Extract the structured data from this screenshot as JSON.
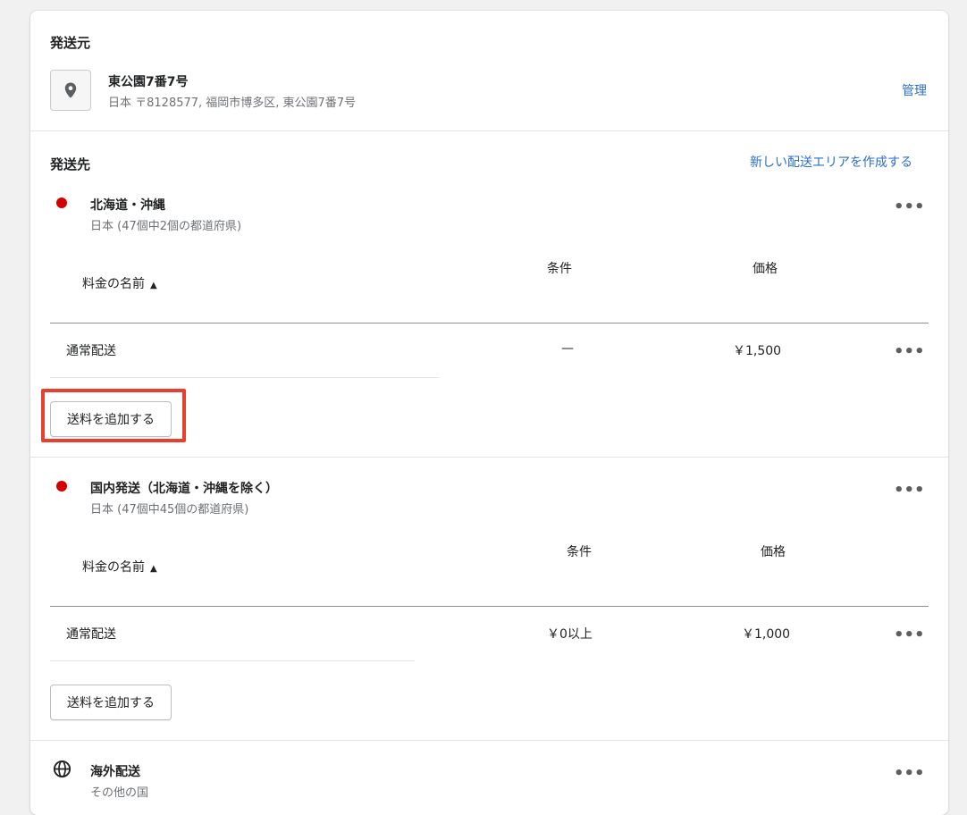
{
  "origin": {
    "heading": "発送元",
    "location_name": "東公園7番7号",
    "address": "日本 〒8128577, 福岡市博多区, 東公園7番7号",
    "manage_link": "管理",
    "icon": "location-pin-icon"
  },
  "destination": {
    "heading": "発送先",
    "create_zone_link": "新しい配送エリアを作成する"
  },
  "zones": [
    {
      "name": "北海道・沖縄",
      "subtitle": "日本 (47個中2個の都道府県)",
      "col_rate_name": "料金の名前",
      "col_condition": "条件",
      "col_price": "価格",
      "sort_indicator": "▲",
      "rates": [
        {
          "name": "通常配送",
          "condition": "—",
          "price": "￥1,500"
        }
      ],
      "add_rate_button": "送料を追加する",
      "color": "#d40000"
    },
    {
      "name": "国内発送（北海道・沖縄を除く）",
      "subtitle": "日本 (47個中45個の都道府県)",
      "col_rate_name": "料金の名前",
      "col_condition": "条件",
      "col_price": "価格",
      "sort_indicator": "▲",
      "rates": [
        {
          "name": "通常配送",
          "condition": "￥0以上",
          "price": "￥1,000"
        }
      ],
      "add_rate_button": "送料を追加する",
      "color": "#d40000"
    },
    {
      "name": "海外配送",
      "subtitle": "その他の国",
      "icon": "globe-icon"
    }
  ],
  "more_actions": "•••"
}
